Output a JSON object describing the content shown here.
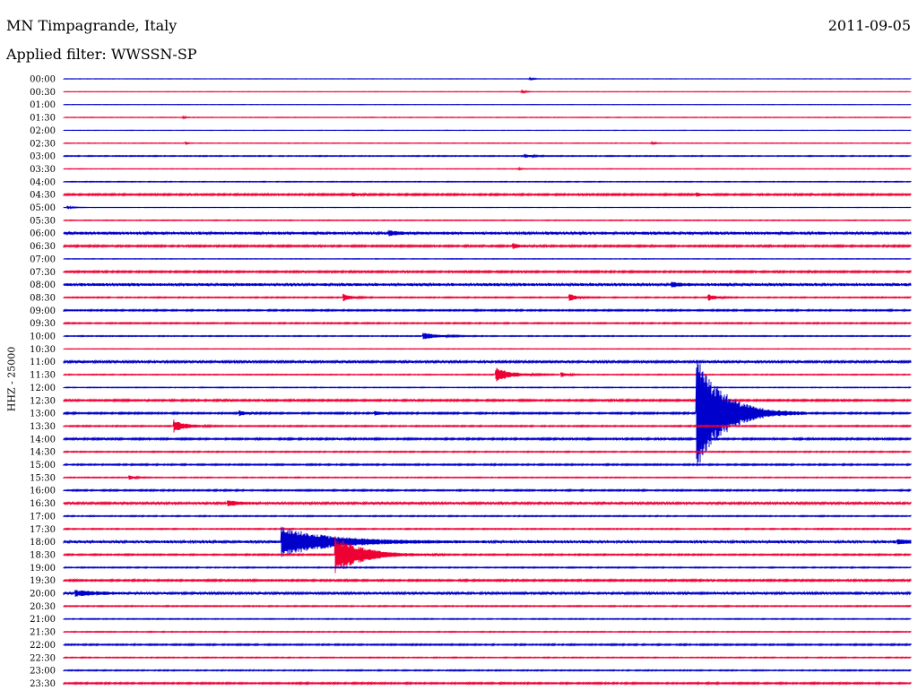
{
  "header": {
    "title": "MN Timpagrande, Italy",
    "date": "2011-09-05",
    "filter": "Applied filter: WWSSN-SP"
  },
  "chart_data": {
    "type": "helicorder",
    "ylabel": "HHZ - 25000",
    "colors": [
      "#0000cc",
      "#ee0033"
    ],
    "tick_labels": [
      "00:00",
      "00:30",
      "01:00",
      "01:30",
      "02:00",
      "02:30",
      "03:00",
      "03:30",
      "04:00",
      "04:30",
      "05:00",
      "05:30",
      "06:00",
      "06:30",
      "07:00",
      "07:30",
      "08:00",
      "08:30",
      "09:00",
      "09:30",
      "10:00",
      "10:30",
      "11:00",
      "11:30",
      "12:00",
      "12:30",
      "13:00",
      "13:30",
      "14:00",
      "14:30",
      "15:00",
      "15:30",
      "16:00",
      "16:30",
      "17:00",
      "17:30",
      "18:00",
      "18:30",
      "19:00",
      "19:30",
      "20:00",
      "20:30",
      "21:00",
      "21:30",
      "22:00",
      "22:30",
      "23:00",
      "23:30"
    ],
    "noise": [
      0.2,
      0.2,
      0.2,
      0.3,
      0.2,
      0.3,
      0.5,
      0.3,
      0.4,
      1.0,
      0.2,
      0.4,
      1.6,
      1.0,
      0.3,
      1.0,
      1.6,
      0.6,
      0.8,
      0.7,
      0.5,
      0.3,
      1.2,
      0.5,
      0.4,
      1.0,
      0.9,
      0.7,
      1.0,
      0.6,
      0.8,
      0.5,
      0.8,
      1.3,
      0.6,
      0.6,
      1.5,
      0.8,
      0.6,
      1.0,
      1.2,
      0.6,
      0.5,
      0.5,
      0.8,
      0.5,
      0.6,
      0.9
    ],
    "events": [
      {
        "row": 0,
        "minute": 16.5,
        "amp": 2,
        "dur": 0.3
      },
      {
        "row": 1,
        "minute": 16.2,
        "amp": 3,
        "dur": 0.3
      },
      {
        "row": 3,
        "minute": 4.2,
        "amp": 2,
        "dur": 0.2
      },
      {
        "row": 5,
        "minute": 4.3,
        "amp": 2,
        "dur": 0.2
      },
      {
        "row": 5,
        "minute": 20.8,
        "amp": 2,
        "dur": 0.3
      },
      {
        "row": 6,
        "minute": 16.3,
        "amp": 2,
        "dur": 0.8
      },
      {
        "row": 7,
        "minute": 16.1,
        "amp": 2,
        "dur": 0.2
      },
      {
        "row": 9,
        "minute": 10.2,
        "amp": 2,
        "dur": 0.6
      },
      {
        "row": 9,
        "minute": 22.4,
        "amp": 2,
        "dur": 0.6
      },
      {
        "row": 10,
        "minute": 0.1,
        "amp": 2,
        "dur": 0.5
      },
      {
        "row": 12,
        "minute": 11.5,
        "amp": 3,
        "dur": 0.8
      },
      {
        "row": 13,
        "minute": 15.9,
        "amp": 3,
        "dur": 0.8
      },
      {
        "row": 16,
        "minute": 21.5,
        "amp": 3,
        "dur": 0.8
      },
      {
        "row": 17,
        "minute": 9.9,
        "amp": 4,
        "dur": 0.8
      },
      {
        "row": 17,
        "minute": 17.9,
        "amp": 4,
        "dur": 0.8
      },
      {
        "row": 17,
        "minute": 22.8,
        "amp": 4,
        "dur": 0.8
      },
      {
        "row": 20,
        "minute": 12.7,
        "amp": 4,
        "dur": 1.4
      },
      {
        "row": 23,
        "minute": 15.3,
        "amp": 8,
        "dur": 1.5
      },
      {
        "row": 23,
        "minute": 17.6,
        "amp": 3,
        "dur": 0.6
      },
      {
        "row": 26,
        "minute": 6.2,
        "amp": 3,
        "dur": 0.6
      },
      {
        "row": 26,
        "minute": 11.0,
        "amp": 2,
        "dur": 1.0
      },
      {
        "row": 26,
        "minute": 22.4,
        "amp": 69,
        "dur": 2.6
      },
      {
        "row": 27,
        "minute": 3.9,
        "amp": 7,
        "dur": 1.2
      },
      {
        "row": 31,
        "minute": 2.3,
        "amp": 3,
        "dur": 0.5
      },
      {
        "row": 33,
        "minute": 5.8,
        "amp": 3,
        "dur": 1.2
      },
      {
        "row": 36,
        "minute": 7.7,
        "amp": 17,
        "dur": 4.5
      },
      {
        "row": 36,
        "minute": 29.5,
        "amp": 3,
        "dur": 0.9
      },
      {
        "row": 37,
        "minute": 9.6,
        "amp": 22,
        "dur": 2.6
      },
      {
        "row": 40,
        "minute": 0.4,
        "amp": 3,
        "dur": 2.5
      }
    ]
  }
}
